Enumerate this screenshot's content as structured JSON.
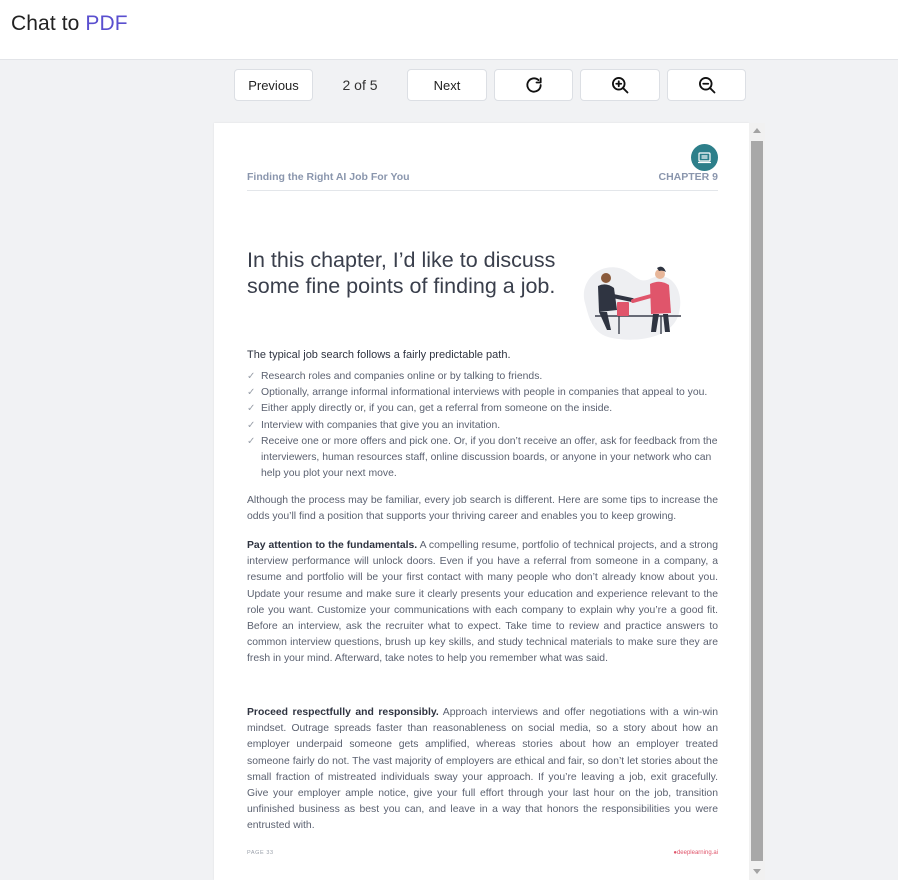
{
  "app": {
    "title_prefix": "Chat to ",
    "title_accent": "PDF",
    "accent_color": "#5a4fcf"
  },
  "toolbar": {
    "previous_label": "Previous",
    "page_indicator": "2 of 5",
    "next_label": "Next",
    "icons": [
      "refresh-icon",
      "zoom-in-icon",
      "zoom-out-icon"
    ]
  },
  "doc": {
    "header_left": "Finding the Right AI Job For You",
    "header_right": "CHAPTER 9",
    "headline": "In this chapter, I’d like to discuss some fine points of finding a job.",
    "lead": "The typical job search follows a fairly predictable path.",
    "checklist": [
      "Research roles and companies online or by talking to friends.",
      "Optionally, arrange informal informational interviews with people in companies that appeal to you.",
      "Either apply directly or, if you can, get a referral from someone on the inside.",
      "Interview with companies that give you an invitation.",
      "Receive one or more offers and pick one. Or, if you don’t receive an offer, ask for feedback from the interviewers, human resources staff, online discussion boards, or anyone in your network who can help you plot your next move."
    ],
    "intro_paragraph": "Although the process may be familiar, every job search is different. Here are some tips to increase the odds you’ll find a position that supports your thriving career and enables you to keep growing.",
    "fundamentals": {
      "heading": "Pay attention to the fundamentals.",
      "body": "A compelling resume, portfolio of technical projects, and a strong interview performance will unlock doors. Even if you have a referral from someone in a company, a resume and portfolio will be your first contact with many people who don’t already know about you. Update your resume and make sure it clearly presents your education and experience relevant to the role you want. Customize your communications with each company to explain why you’re a good fit. Before an interview, ask the recruiter what to expect. Take time to review and practice answers to common interview questions, brush up key skills, and study technical materials to make sure they are fresh in your mind. Afterward, take notes to help you remember what was said."
    },
    "respectful": {
      "heading": "Proceed respectfully and responsibly.",
      "body": "Approach interviews and offer negotiations with a win-win mindset. Outrage spreads faster than reasonableness on social media, so a story about how an employer underpaid someone gets amplified, whereas stories about how an employer treated someone fairly do not. The vast majority of employers are ethical and fair, so don’t let stories about the small fraction of mistreated individuals sway your approach. If you’re leaving a job, exit gracefully. Give your employer ample notice, give your full effort through your last hour on the job, transition unfinished business as best you can, and leave in a way that honors the responsibilities you were entrusted with."
    },
    "footer_page": "PAGE 33",
    "footer_brand": "deeplearning.ai"
  }
}
